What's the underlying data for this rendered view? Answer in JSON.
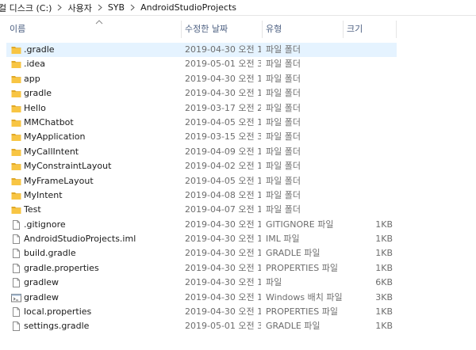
{
  "breadcrumb": [
    "컬 디스크 (C:)",
    "사용자",
    "SYB",
    "AndroidStudioProjects"
  ],
  "columns": {
    "name": "이름",
    "date": "수정한 날짜",
    "type": "유형",
    "size": "크기"
  },
  "colors": {
    "folder": "#f8c543",
    "folder_dark": "#e0a826",
    "selected": "#e5f3ff",
    "header_text": "#4d6082"
  },
  "items": [
    {
      "name": ".gradle",
      "date": "2019-04-30 오전 1...",
      "type": "파일 폴더",
      "size": "",
      "icon": "folder-icon",
      "selected": true
    },
    {
      "name": ".idea",
      "date": "2019-05-01 오전 3...",
      "type": "파일 폴더",
      "size": "",
      "icon": "folder-icon"
    },
    {
      "name": "app",
      "date": "2019-04-30 오전 1...",
      "type": "파일 폴더",
      "size": "",
      "icon": "folder-icon"
    },
    {
      "name": "gradle",
      "date": "2019-04-30 오전 1...",
      "type": "파일 폴더",
      "size": "",
      "icon": "folder-icon"
    },
    {
      "name": "Hello",
      "date": "2019-03-17 오전 2...",
      "type": "파일 폴더",
      "size": "",
      "icon": "folder-icon"
    },
    {
      "name": "MMChatbot",
      "date": "2019-04-05 오전 1...",
      "type": "파일 폴더",
      "size": "",
      "icon": "folder-icon"
    },
    {
      "name": "MyApplication",
      "date": "2019-03-15 오전 3...",
      "type": "파일 폴더",
      "size": "",
      "icon": "folder-icon"
    },
    {
      "name": "MyCallIntent",
      "date": "2019-04-09 오전 1...",
      "type": "파일 폴더",
      "size": "",
      "icon": "folder-icon"
    },
    {
      "name": "MyConstraintLayout",
      "date": "2019-04-02 오전 1...",
      "type": "파일 폴더",
      "size": "",
      "icon": "folder-icon"
    },
    {
      "name": "MyFrameLayout",
      "date": "2019-04-05 오전 1...",
      "type": "파일 폴더",
      "size": "",
      "icon": "folder-icon"
    },
    {
      "name": "MyIntent",
      "date": "2019-04-08 오전 1...",
      "type": "파일 폴더",
      "size": "",
      "icon": "folder-icon"
    },
    {
      "name": "Test",
      "date": "2019-04-07 오전 1...",
      "type": "파일 폴더",
      "size": "",
      "icon": "folder-icon"
    },
    {
      "name": ".gitignore",
      "date": "2019-04-30 오전 1...",
      "type": "GITIGNORE 파일",
      "size": "1KB",
      "icon": "file-icon"
    },
    {
      "name": "AndroidStudioProjects.iml",
      "date": "2019-04-30 오전 1...",
      "type": "IML 파일",
      "size": "1KB",
      "icon": "file-icon"
    },
    {
      "name": "build.gradle",
      "date": "2019-04-30 오전 1...",
      "type": "GRADLE 파일",
      "size": "1KB",
      "icon": "file-icon"
    },
    {
      "name": "gradle.properties",
      "date": "2019-04-30 오전 1...",
      "type": "PROPERTIES 파일",
      "size": "1KB",
      "icon": "file-icon"
    },
    {
      "name": "gradlew",
      "date": "2019-04-30 오전 1...",
      "type": "파일",
      "size": "6KB",
      "icon": "file-icon"
    },
    {
      "name": "gradlew",
      "date": "2019-04-30 오전 1...",
      "type": "Windows 배치 파일",
      "size": "3KB",
      "icon": "batch-file-icon"
    },
    {
      "name": "local.properties",
      "date": "2019-04-30 오전 1...",
      "type": "PROPERTIES 파일",
      "size": "1KB",
      "icon": "file-icon"
    },
    {
      "name": "settings.gradle",
      "date": "2019-05-01 오전 3...",
      "type": "GRADLE 파일",
      "size": "1KB",
      "icon": "file-icon"
    }
  ]
}
